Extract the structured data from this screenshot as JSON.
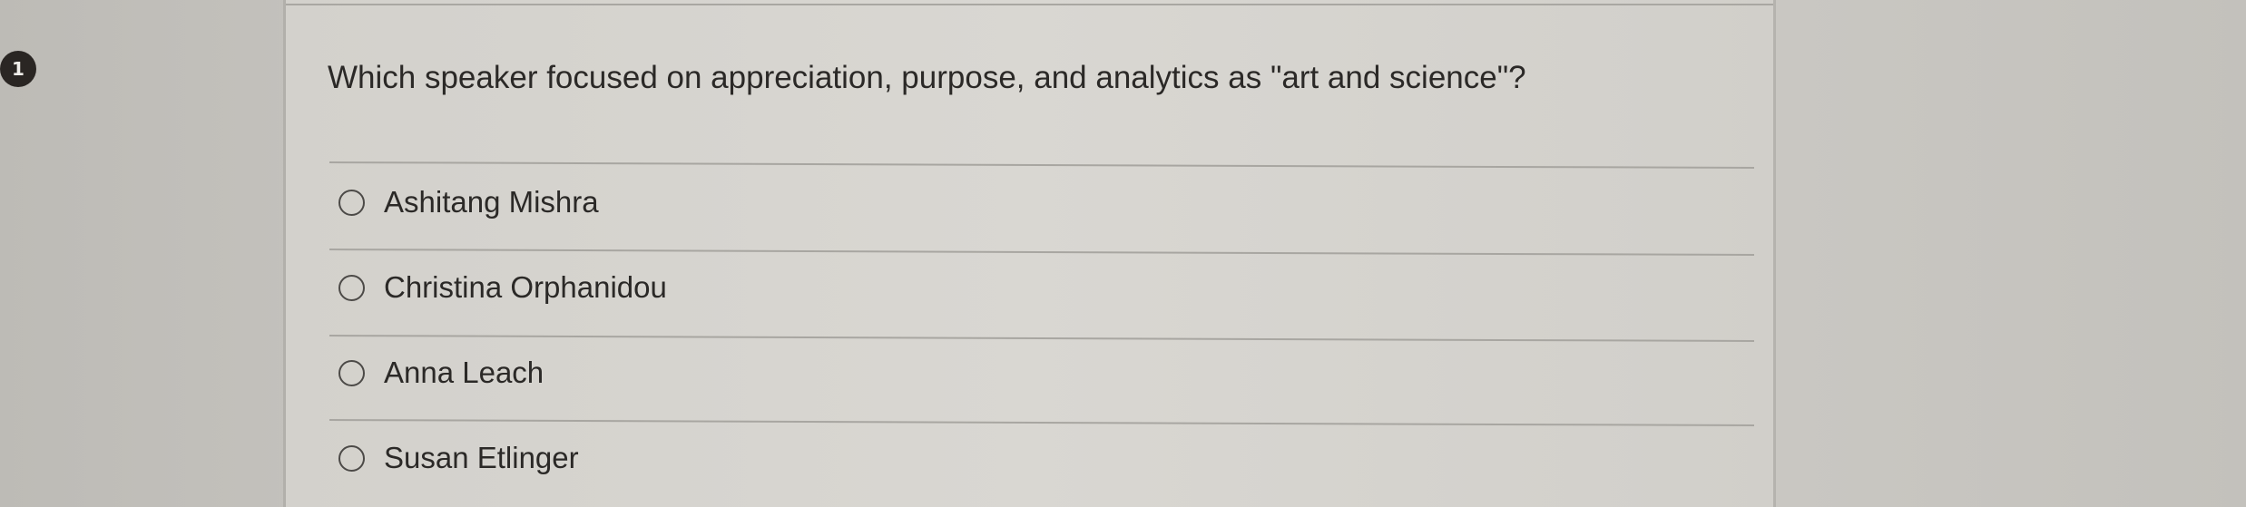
{
  "question": {
    "number": "1",
    "text": "Which speaker focused on appreciation, purpose, and analytics as \"art and science\"?",
    "options": [
      {
        "label": "Ashitang Mishra",
        "selected": false
      },
      {
        "label": "Christina Orphanidou",
        "selected": false
      },
      {
        "label": "Anna Leach",
        "selected": false
      },
      {
        "label": "Susan Etlinger",
        "selected": false
      }
    ]
  }
}
